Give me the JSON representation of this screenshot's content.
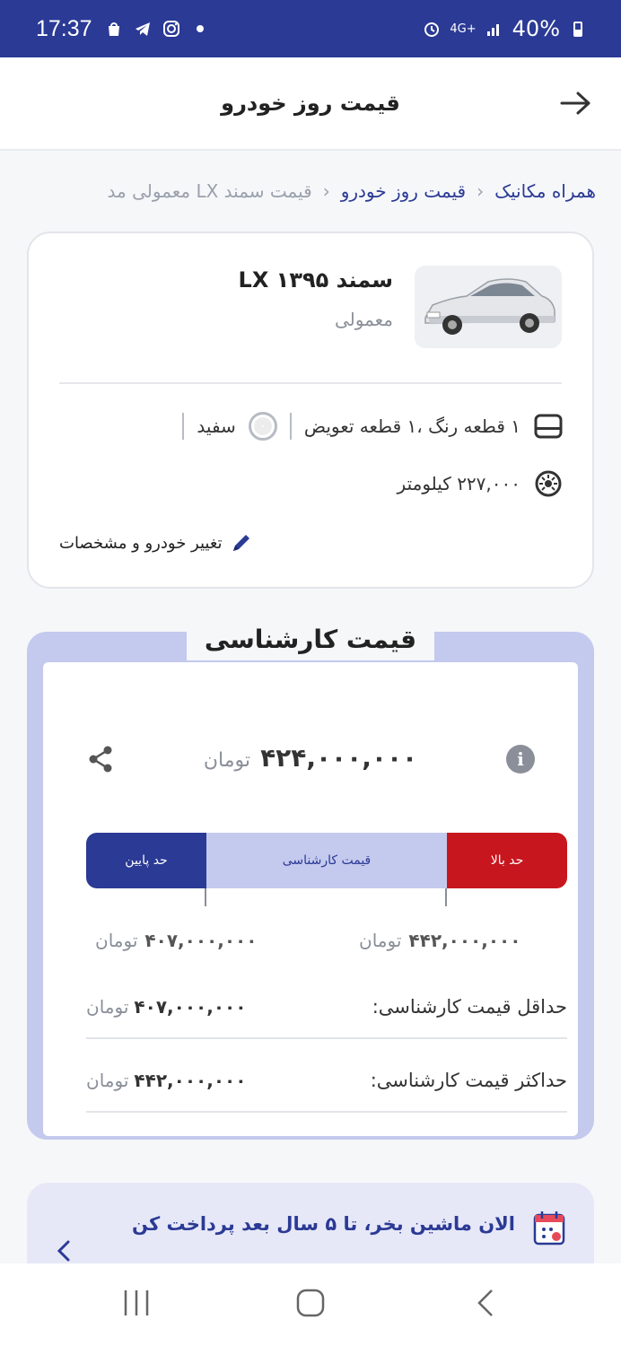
{
  "status_bar": {
    "time": "17:37",
    "battery": "40%",
    "network": "4G+"
  },
  "header": {
    "title": "قیمت روز خودرو",
    "back_icon": "arrow-right-icon"
  },
  "breadcrumb": {
    "items": [
      "همراه مکانیک",
      "قیمت روز خودرو"
    ],
    "current": "قیمت سمند LX معمولی مد"
  },
  "car": {
    "name": "سمند LX ۱۳۹۵",
    "trim": "معمولی",
    "condition": "۱ قطعه رنگ ،۱ قطعه تعویض",
    "color": "سفید",
    "mileage": "۲۲۷,۰۰۰ کیلومتر",
    "edit_label": "تغییر خودرو و مشخصات"
  },
  "price": {
    "title": "قیمت کارشناسی",
    "value": "۴۲۴,۰۰۰,۰۰۰",
    "unit": "تومان",
    "segments": {
      "high": "حد بالا",
      "mid": "قیمت کارشناسی",
      "low": "حد پایین"
    },
    "high_value": "۴۴۲,۰۰۰,۰۰۰",
    "low_value": "۴۰۷,۰۰۰,۰۰۰",
    "min_label": "حداقل قیمت کارشناسی:",
    "min_value": "۴۰۷,۰۰۰,۰۰۰",
    "max_label": "حداکثر قیمت کارشناسی:",
    "max_value": "۴۴۲,۰۰۰,۰۰۰"
  },
  "promo": {
    "text": "الان ماشین بخر، تا ۵ سال بعد پرداخت کن"
  },
  "colors": {
    "primary": "#2b3a95",
    "accent_red": "#c7161e",
    "light_blue": "#c4c9ee"
  }
}
